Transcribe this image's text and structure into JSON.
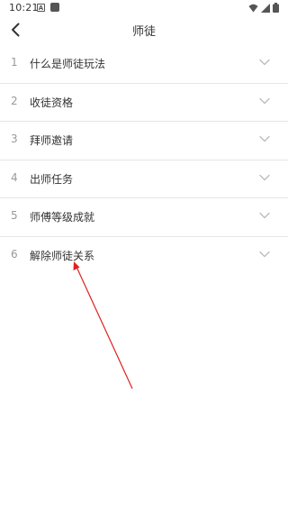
{
  "status_bar": {
    "time": "10:21",
    "a_icon_label": "A",
    "icons": [
      "wifi-icon",
      "signal-icon",
      "battery-icon"
    ]
  },
  "header": {
    "title": "师徒",
    "back_icon": "chevron-left-icon"
  },
  "faq": {
    "items": [
      {
        "num": "1",
        "label": "什么是师徒玩法"
      },
      {
        "num": "2",
        "label": "收徒资格"
      },
      {
        "num": "3",
        "label": "拜师邀请"
      },
      {
        "num": "4",
        "label": "出师任务"
      },
      {
        "num": "5",
        "label": "师傅等级成就"
      },
      {
        "num": "6",
        "label": "解除师徒关系"
      }
    ],
    "expand_icon": "chevron-down-icon"
  },
  "annotation": {
    "arrow_color": "#e02020"
  },
  "colors": {
    "text_primary": "#333333",
    "text_secondary": "#999999",
    "divider": "#e6e6e6",
    "chevron": "#bbbbbb"
  }
}
